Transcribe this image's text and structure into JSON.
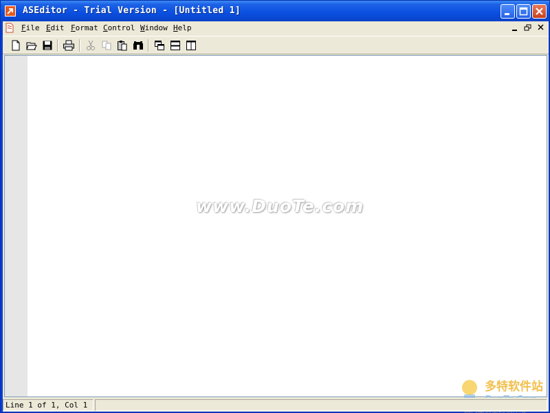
{
  "window": {
    "title": "ASEditor - Trial Version - [Untitled 1]"
  },
  "menu": {
    "items": [
      {
        "mnemonic": "F",
        "rest": "ile"
      },
      {
        "mnemonic": "E",
        "rest": "dit"
      },
      {
        "mnemonic": "F",
        "rest": "ormat"
      },
      {
        "mnemonic": "C",
        "rest": "ontrol"
      },
      {
        "mnemonic": "W",
        "rest": "indow"
      },
      {
        "mnemonic": "H",
        "rest": "elp"
      }
    ]
  },
  "toolbar": {
    "buttons": [
      "new-file",
      "open-folder",
      "save",
      "print",
      "cut",
      "copy",
      "paste",
      "find",
      "cascade-windows",
      "tile-horizontal",
      "tile-vertical"
    ]
  },
  "watermark": {
    "text": "www.DuoTe.com",
    "logo_lines": [
      "多特软件站",
      "DuoTe.Com",
      "国内最安全的软件站"
    ]
  },
  "status": {
    "position": "Line 1 of 1, Col 1"
  },
  "colors": {
    "titlebar": "#0a4fe0",
    "chrome": "#ece9d8",
    "gutter": "#e6e6e6",
    "close_button": "#c8401c"
  }
}
